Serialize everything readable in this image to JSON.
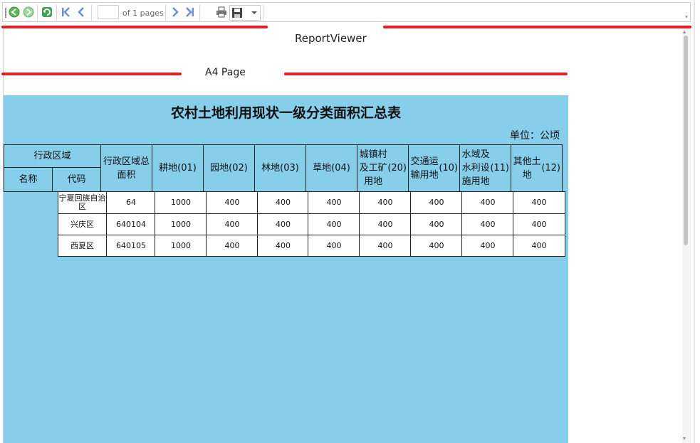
{
  "toolbar": {
    "page_current": "",
    "page_of": "of 1 pages",
    "icons": [
      "back-icon",
      "forward-icon",
      "refresh-icon",
      "first-page-icon",
      "prev-page-icon",
      "next-page-icon",
      "last-page-icon",
      "print-icon",
      "save-icon",
      "dropdown-icon"
    ]
  },
  "viewer": {
    "title": "ReportViewer",
    "page_size": "A4 Page"
  },
  "report": {
    "title": "农村土地利用现状一级分类面积汇总表",
    "unit": "单位：公顷",
    "header_group": "行政区域",
    "header_name": "名称",
    "header_code": "代码",
    "columns": [
      {
        "label": "行政区域总面积"
      },
      {
        "label": "耕地",
        "code": "(01)"
      },
      {
        "label": "园地",
        "code": "(02)"
      },
      {
        "label": "林地",
        "code": "(03)"
      },
      {
        "label": "草地",
        "code": "(04)"
      },
      {
        "label": "城镇村及工矿用地",
        "code": "(20)"
      },
      {
        "label": "交通运输用地",
        "code": "(10)"
      },
      {
        "label": "水域及水利设施用地",
        "code": "(11)"
      },
      {
        "label": "其他土地",
        "code": "(12)"
      }
    ],
    "rows": [
      {
        "name": "宁夏回族自治区",
        "values": [
          "64",
          "1000",
          "400",
          "400",
          "400",
          "400",
          "400",
          "400",
          "400"
        ]
      },
      {
        "name": "兴庆区",
        "values": [
          "640104",
          "1000",
          "400",
          "400",
          "400",
          "400",
          "400",
          "400",
          "400"
        ]
      },
      {
        "name": "西夏区",
        "values": [
          "640105",
          "1000",
          "400",
          "400",
          "400",
          "400",
          "400",
          "400",
          "400"
        ]
      }
    ]
  },
  "colors": {
    "report_bg": "#87CEEB",
    "accent_lines": "#e0202a"
  }
}
